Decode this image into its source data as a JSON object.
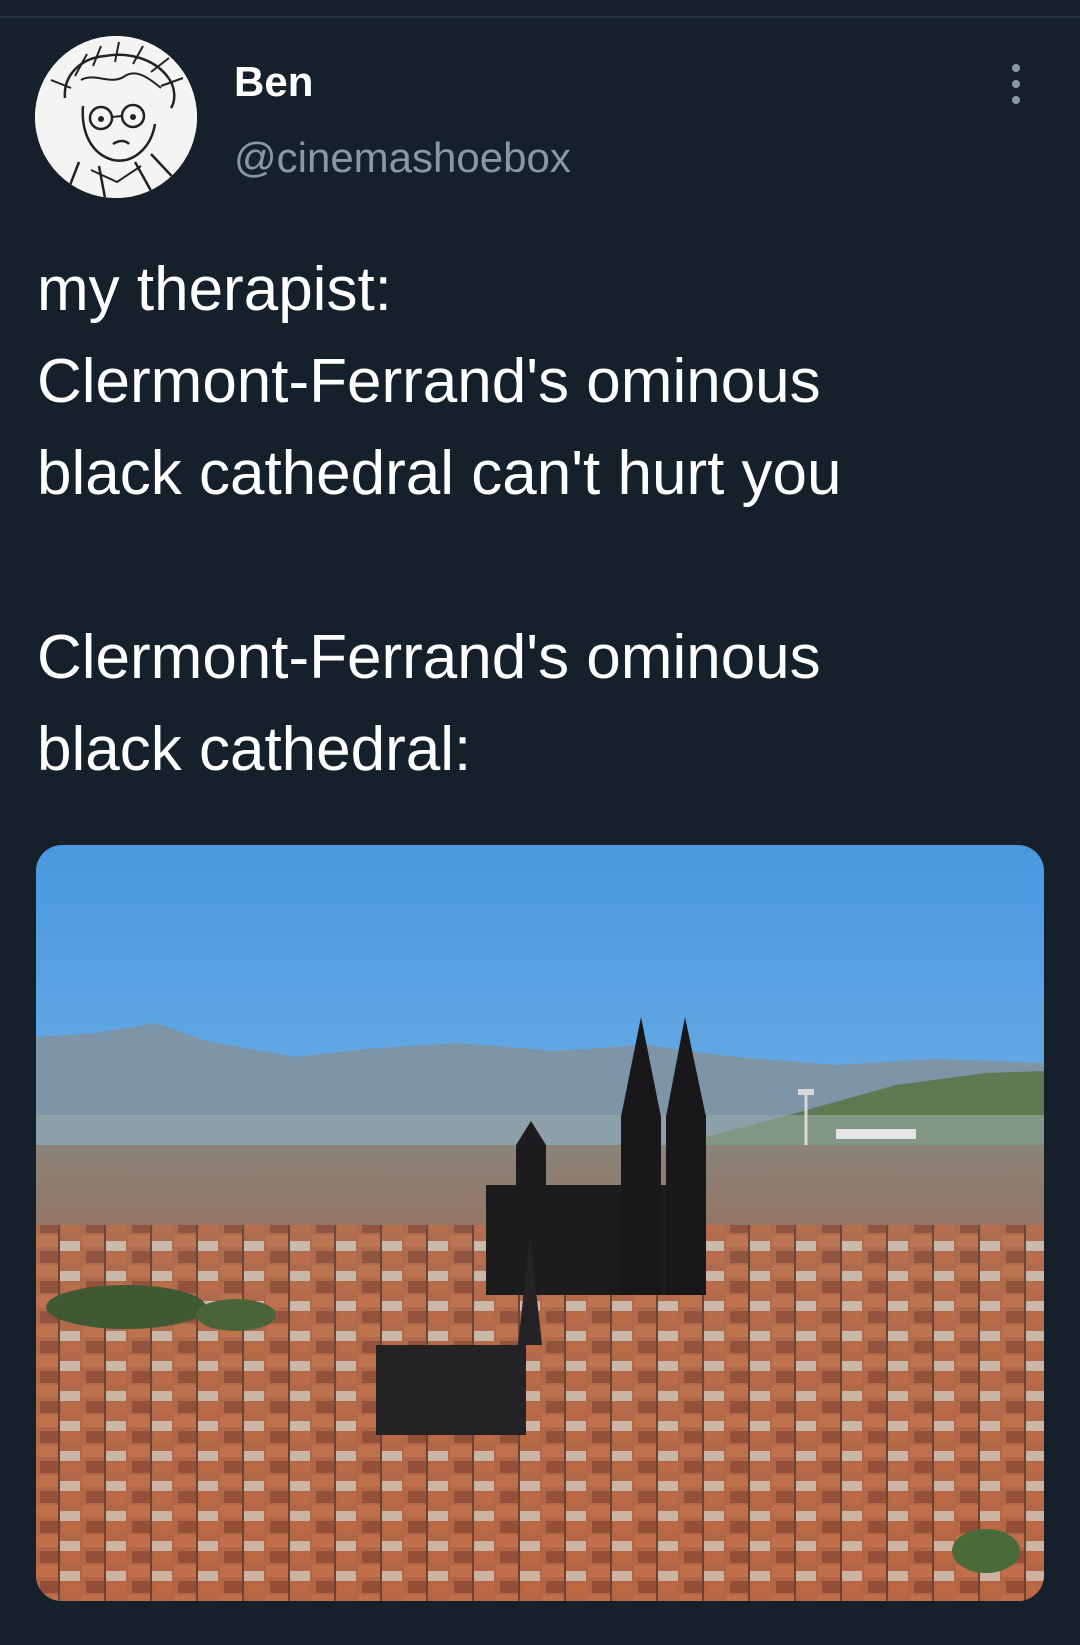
{
  "tweet": {
    "display_name": "Ben",
    "handle": "@cinemashoebox",
    "avatar_icon": "sketched-face-avatar",
    "more_icon": "more-vertical-icon",
    "text_lines": [
      "my therapist:",
      "Clermont-Ferrand's ominous",
      "black cathedral can't hurt you",
      "",
      "Clermont-Ferrand's ominous",
      "black cathedral:"
    ],
    "media": {
      "kind": "photo",
      "subject": "cityscape-with-black-cathedral"
    }
  },
  "colors": {
    "background": "#15202b",
    "text": "#ffffff",
    "secondary_text": "#8899a6"
  }
}
